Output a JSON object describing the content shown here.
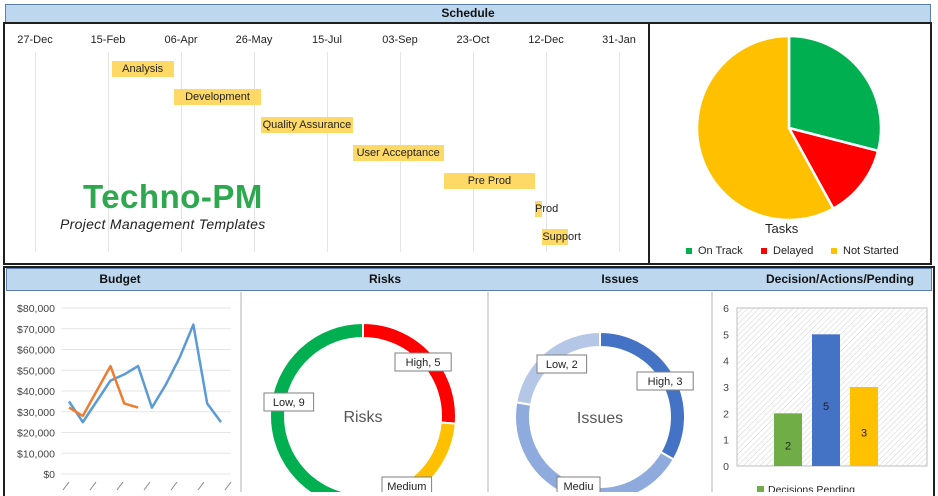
{
  "schedule": {
    "title": "Schedule",
    "dates": [
      "27-Dec",
      "15-Feb",
      "06-Apr",
      "26-May",
      "15-Jul",
      "03-Sep",
      "23-Oct",
      "12-Dec",
      "31-Jan"
    ],
    "tasks": [
      {
        "name": "Analysis",
        "start": 1.05,
        "end": 1.9
      },
      {
        "name": "Development",
        "start": 1.9,
        "end": 3.1
      },
      {
        "name": "Quality Assurance",
        "start": 3.1,
        "end": 4.35
      },
      {
        "name": "User Acceptance",
        "start": 4.35,
        "end": 5.6
      },
      {
        "name": "Pre Prod",
        "start": 5.6,
        "end": 6.85
      },
      {
        "name": "Prod",
        "start": 6.85,
        "end": 6.95
      },
      {
        "name": "Support",
        "start": 6.95,
        "end": 7.3
      }
    ]
  },
  "branding": {
    "logo": "Techno-PM",
    "tagline": "Project Management Templates"
  },
  "tasks_pie": {
    "title": "Tasks",
    "legend": [
      {
        "label": "On Track",
        "color": "#00b050"
      },
      {
        "label": "Delayed",
        "color": "#ff0000"
      },
      {
        "label": "Not Started",
        "color": "#ffc000"
      }
    ]
  },
  "sections": {
    "budget": "Budget",
    "risks": "Risks",
    "issues": "Issues",
    "decisions": "Decision/Actions/Pending"
  },
  "budget": {
    "y_ticks": [
      "$80,000",
      "$70,000",
      "$60,000",
      "$50,000",
      "$40,000",
      "$30,000",
      "$20,000",
      "$10,000",
      "$0"
    ]
  },
  "risks": {
    "center": "Risks",
    "labels": [
      "High, 5",
      "Low, 9",
      "Medium"
    ]
  },
  "issues": {
    "center": "Issues",
    "labels": [
      "Low, 2",
      "High, 3",
      "Mediu"
    ]
  },
  "decisions": {
    "y_ticks": [
      "6",
      "5",
      "4",
      "3",
      "2",
      "1",
      "0"
    ],
    "legend": "Decisions Pending"
  },
  "chart_data": [
    {
      "type": "pie",
      "title": "Tasks",
      "categories": [
        "On Track",
        "Delayed",
        "Not Started"
      ],
      "values": [
        29,
        13,
        58
      ]
    },
    {
      "type": "line",
      "title": "Budget",
      "ylim": [
        0,
        80000
      ],
      "series": [
        {
          "values": [
            35000,
            25000,
            35000,
            45000,
            48000,
            52000,
            32000,
            43000,
            56000,
            72000,
            34000,
            25000
          ]
        },
        {
          "values": [
            32000,
            28000,
            40000,
            52000,
            34000,
            32000
          ]
        }
      ]
    },
    {
      "type": "pie",
      "title": "Risks",
      "categories": [
        "High",
        "Medium",
        "Low"
      ],
      "values": [
        5,
        5,
        9
      ]
    },
    {
      "type": "pie",
      "title": "Issues",
      "categories": [
        "High",
        "Medium",
        "Low"
      ],
      "values": [
        3,
        4,
        2
      ]
    },
    {
      "type": "bar",
      "title": "Decision/Actions/Pending",
      "ylim": [
        0,
        6
      ],
      "categories": [
        "",
        "",
        ""
      ],
      "values": [
        2,
        5,
        3
      ],
      "colors": [
        "#70ad47",
        "#4472c4",
        "#ffc000"
      ]
    }
  ]
}
